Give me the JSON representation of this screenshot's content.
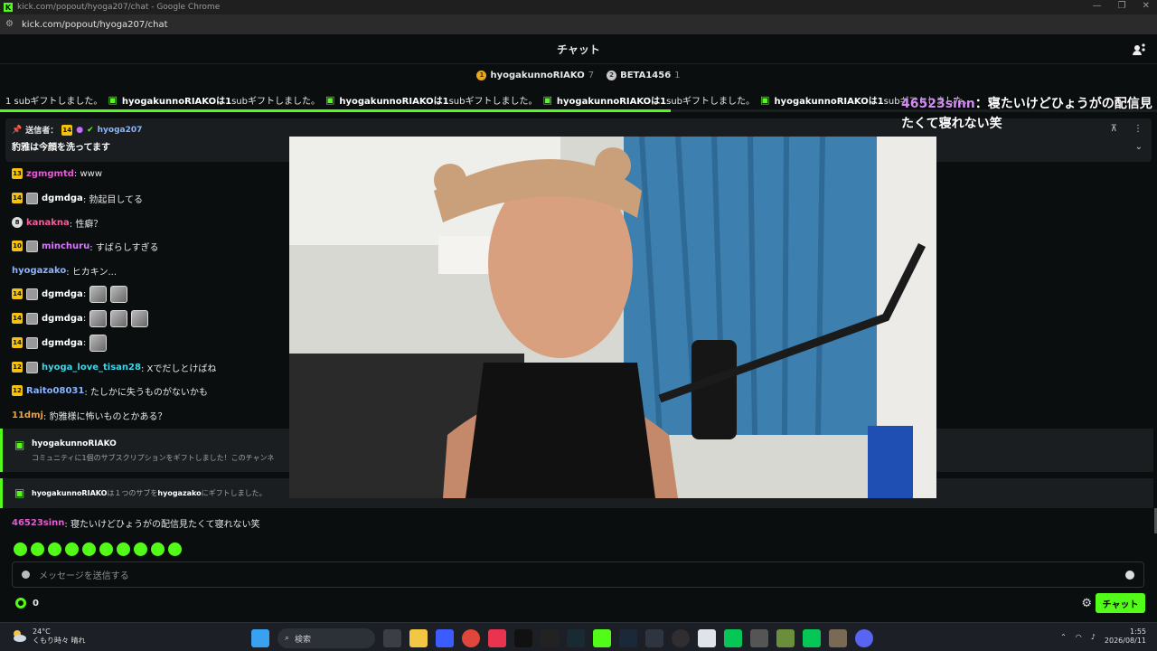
{
  "window": {
    "title": "kick.com/popout/hyoga207/chat - Google Chrome",
    "url": "kick.com/popout/hyoga207/chat"
  },
  "chat": {
    "title": "チャット"
  },
  "leaderboard": [
    {
      "rank": "1",
      "user": "hyogakunnoRIAKO",
      "count": "7"
    },
    {
      "rank": "2",
      "user": "BETA1456",
      "count": "1"
    }
  ],
  "ticker": {
    "lead": "1 subギフトしました。",
    "items": [
      {
        "user": "hyogakunnoRIAKOは1",
        "text": " subギフトしました。"
      },
      {
        "user": "hyogakunnoRIAKOは1",
        "text": " subギフトしました。"
      },
      {
        "user": "hyogakunnoRIAKOは1",
        "text": " subギフトしました。"
      },
      {
        "user": "hyogakunnoRIAKOは1",
        "text": " subギフトしました。"
      }
    ],
    "progress": 0.58
  },
  "pinned": {
    "label": "送信者：",
    "badge": "14",
    "user": "hyoga207",
    "message": "豹雅は今顔を洗ってます"
  },
  "messages": [
    {
      "badge": "13",
      "avatar": false,
      "user": "zgmgmtd",
      "color": "#e05dd1",
      "text": ": www",
      "emotes": 0
    },
    {
      "badge": "14",
      "avatar": true,
      "user": "dgmdga",
      "color": "#ffffff",
      "text": ": 勃起目してる",
      "emotes": 0
    },
    {
      "badge": "8",
      "avatar": false,
      "user": "kanakna",
      "color": "#f25f9a",
      "text": ": 性癖？",
      "emotes": 0
    },
    {
      "badge": "10",
      "avatar": true,
      "user": "minchuru",
      "color": "#d979ff",
      "text": ": すばらしすぎる",
      "emotes": 0
    },
    {
      "badge": "",
      "avatar": false,
      "user": "hyogazako",
      "color": "#8ab4ff",
      "text": ": ヒカキン...",
      "emotes": 0
    },
    {
      "badge": "14",
      "avatar": true,
      "user": "dgmdga",
      "color": "#ffffff",
      "text": ":",
      "emotes": 2
    },
    {
      "badge": "14",
      "avatar": true,
      "user": "dgmdga",
      "color": "#ffffff",
      "text": ":",
      "emotes": 3
    },
    {
      "badge": "14",
      "avatar": true,
      "user": "dgmdga",
      "color": "#ffffff",
      "text": ":",
      "emotes": 1
    },
    {
      "badge": "12",
      "avatar": true,
      "user": "hyoga_love_tisan28",
      "color": "#3fd5e8",
      "text": ": Xでだしとけばね",
      "emotes": 0
    },
    {
      "badge": "12",
      "avatar": false,
      "user": "Raito08031",
      "color": "#8ab4ff",
      "text": ": たしかに失うものがないかも",
      "emotes": 0
    },
    {
      "badge": "",
      "avatar": false,
      "user": "11dmj",
      "color": "#f0a23c",
      "text": ": 豹雅様に怖いものとかある？",
      "emotes": 0
    }
  ],
  "events": {
    "gift1_user": "hyogakunnoRIAKO",
    "gift1_text": "コミュニティに1個のサブスクリプションをギフトしました！このチャンネ",
    "gift2_user": "hyogakunnoRIAKO",
    "gift2_mid": "は１つのサブを",
    "gift2_target": "hyogazako",
    "gift2_end": "にギフトしました。"
  },
  "last_message": {
    "user": "46523sinn",
    "text": ": 寝たいけどひょうがの配信見たくて寝れない笑"
  },
  "overlay": {
    "user": "46523sinn",
    "text": "：寝たいけどひょうがの配信見たくて寝れない笑"
  },
  "input": {
    "placeholder": "メッセージを送信する"
  },
  "points": "0",
  "send_label": "チャット",
  "taskbar": {
    "temp": "24°C",
    "weather": "くもり時々 晴れ",
    "search": "検索",
    "time": "1:55",
    "date": "2026/08/11"
  },
  "colors": {
    "accent": "#53fc18",
    "background": "#0b0e0f"
  }
}
